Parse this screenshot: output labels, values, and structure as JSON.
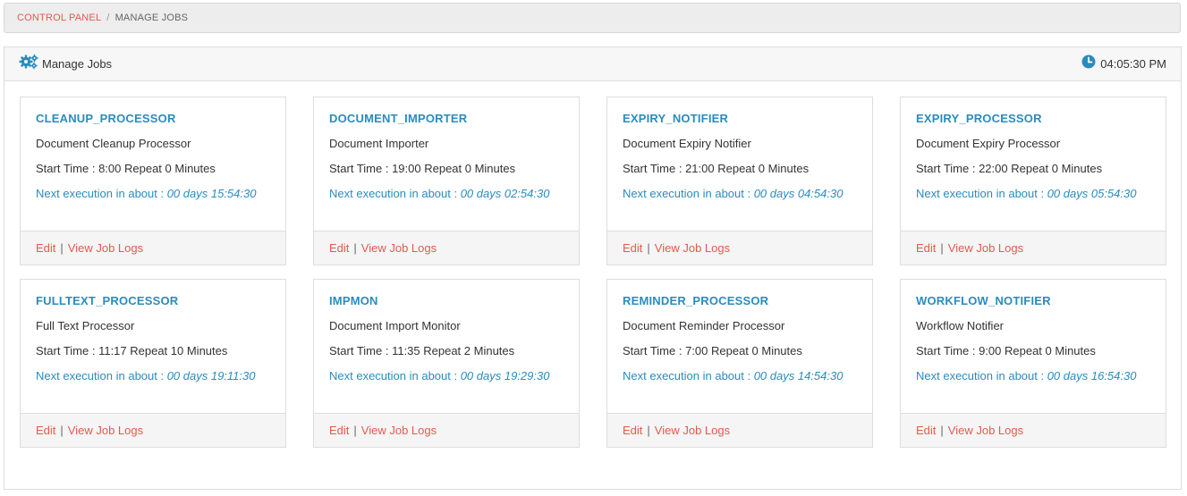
{
  "breadcrumb": {
    "root": "CONTROL PANEL",
    "separator": "/",
    "current": "MANAGE JOBS"
  },
  "panel": {
    "title": "Manage Jobs",
    "title_icon": "gears-icon",
    "clock_icon": "clock-icon",
    "time": "04:05:30 PM"
  },
  "labels": {
    "next_prefix": "Next execution in about : ",
    "edit": "Edit",
    "pipe": "|",
    "view_logs": "View Job Logs"
  },
  "colors": {
    "accent_blue": "#2b8bbd",
    "link_red": "#e15b4f"
  },
  "jobs": [
    {
      "name": "CLEANUP_PROCESSOR",
      "desc": "Document Cleanup Processor",
      "start": "Start Time : 8:00 Repeat 0 Minutes",
      "next": "00 days 15:54:30"
    },
    {
      "name": "DOCUMENT_IMPORTER",
      "desc": "Document Importer",
      "start": "Start Time : 19:00 Repeat 0 Minutes",
      "next": "00 days 02:54:30"
    },
    {
      "name": "EXPIRY_NOTIFIER",
      "desc": "Document Expiry Notifier",
      "start": "Start Time : 21:00 Repeat 0 Minutes",
      "next": "00 days 04:54:30"
    },
    {
      "name": "EXPIRY_PROCESSOR",
      "desc": "Document Expiry Processor",
      "start": "Start Time : 22:00 Repeat 0 Minutes",
      "next": "00 days 05:54:30"
    },
    {
      "name": "FULLTEXT_PROCESSOR",
      "desc": "Full Text Processor",
      "start": "Start Time : 11:17 Repeat 10 Minutes",
      "next": "00 days 19:11:30"
    },
    {
      "name": "IMPMON",
      "desc": "Document Import Monitor",
      "start": "Start Time : 11:35 Repeat 2 Minutes",
      "next": "00 days 19:29:30"
    },
    {
      "name": "REMINDER_PROCESSOR",
      "desc": "Document Reminder Processor",
      "start": "Start Time : 7:00 Repeat 0 Minutes",
      "next": "00 days 14:54:30"
    },
    {
      "name": "WORKFLOW_NOTIFIER",
      "desc": "Workflow Notifier",
      "start": "Start Time : 9:00 Repeat 0 Minutes",
      "next": "00 days 16:54:30"
    }
  ]
}
